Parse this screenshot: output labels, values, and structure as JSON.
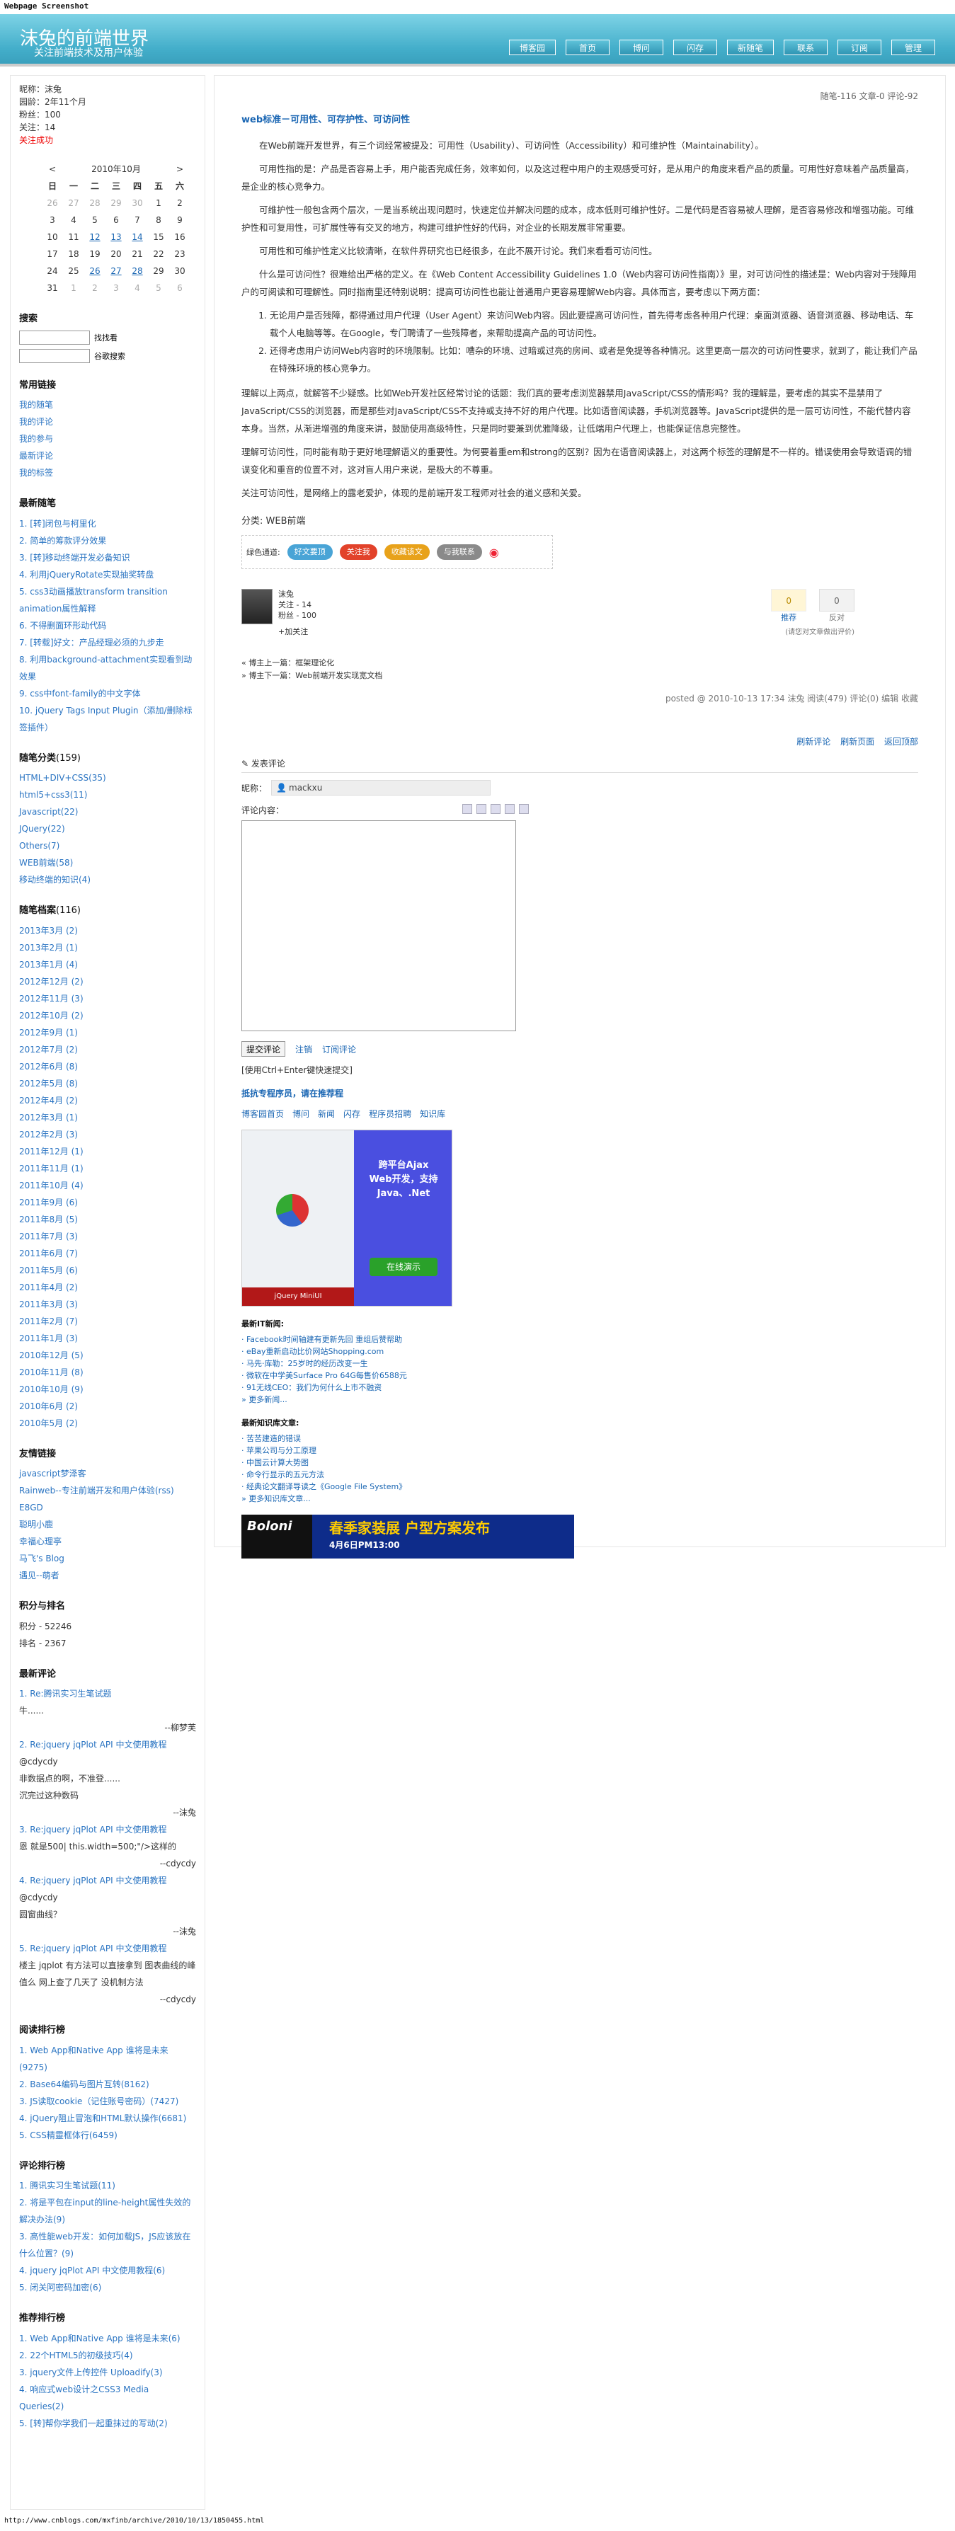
{
  "page_heading": "Webpage Screenshot",
  "blog": {
    "title": "沫兔的前端世界",
    "subtitle": "关注前端技术及用户体验"
  },
  "nav": [
    "博客园",
    "首页",
    "博问",
    "闪存",
    "新随笔",
    "联系",
    "订阅",
    "管理"
  ],
  "profile": {
    "nick": "昵称：沫兔",
    "age": "园龄：2年11个月",
    "fans": "粉丝：100",
    "follow": "关注：14",
    "added": "关注成功"
  },
  "calendar": {
    "caption": "2010年10月",
    "prev": "<",
    "next": ">",
    "weekdays": [
      "日",
      "一",
      "二",
      "三",
      "四",
      "五",
      "六"
    ],
    "rows": [
      [
        "26",
        "27",
        "28",
        "29",
        "30",
        "1",
        "2"
      ],
      [
        "3",
        "4",
        "5",
        "6",
        "7",
        "8",
        "9"
      ],
      [
        "10",
        "11",
        "12",
        "13",
        "14",
        "15",
        "16"
      ],
      [
        "17",
        "18",
        "19",
        "20",
        "21",
        "22",
        "23"
      ],
      [
        "24",
        "25",
        "26",
        "27",
        "28",
        "29",
        "30"
      ],
      [
        "31",
        "1",
        "2",
        "3",
        "4",
        "5",
        "6"
      ]
    ]
  },
  "search": {
    "title": "搜索",
    "btn1": "找找看",
    "btn2": "谷歌搜索"
  },
  "links": {
    "title": "常用链接",
    "items": [
      "我的随笔",
      "我的评论",
      "我的参与",
      "最新评论",
      "我的标签"
    ]
  },
  "recent_posts": {
    "title": "最新随笔",
    "items": [
      "1. [转]闭包与柯里化",
      "2. 简单的筹款评分效果",
      "3. [转]移动终端开发必备知识",
      "4. 利用jQueryRotate实现抽奖转盘",
      "5. css3动画播放transform transition animation属性解释",
      "6. 不得删面环形动代码",
      "7. [转载]好文：产品经理必须的九步走",
      "8. 利用background-attachment实现看到动效果",
      "9. css中font-family的中文字体",
      "10. jQuery Tags Input Plugin（添加/删除标签插件）"
    ]
  },
  "categories": {
    "title": "随笔分类",
    "count": "(159)",
    "items": [
      "HTML+DIV+CSS(35)",
      "html5+css3(11)",
      "Javascript(22)",
      "JQuery(22)",
      "Others(7)",
      "WEB前端(58)",
      "移动终端的知识(4)"
    ]
  },
  "archive": {
    "title": "随笔档案",
    "count": "(116)",
    "items": [
      "2013年3月 (2)",
      "2013年2月 (1)",
      "2013年1月 (4)",
      "2012年12月 (2)",
      "2012年11月 (3)",
      "2012年10月 (2)",
      "2012年9月 (1)",
      "2012年7月 (2)",
      "2012年6月 (8)",
      "2012年5月 (8)",
      "2012年4月 (2)",
      "2012年3月 (1)",
      "2012年2月 (3)",
      "2011年12月 (1)",
      "2011年11月 (1)",
      "2011年10月 (4)",
      "2011年9月 (6)",
      "2011年8月 (5)",
      "2011年7月 (3)",
      "2011年6月 (7)",
      "2011年5月 (6)",
      "2011年4月 (2)",
      "2011年3月 (3)",
      "2011年2月 (7)",
      "2011年1月 (3)",
      "2010年12月 (5)",
      "2010年11月 (8)",
      "2010年10月 (9)",
      "2010年6月 (2)",
      "2010年5月 (2)"
    ]
  },
  "friends": {
    "title": "友情链接",
    "items": [
      "javascript梦泽客",
      "Rainweb--专注前端开发和用户体验(rss)",
      "E8GD",
      "聪明小鹿",
      "幸福心理亭",
      "马飞's Blog",
      "遇见--萌者"
    ]
  },
  "score": {
    "title": "积分与排名",
    "points": "积分 - 52246",
    "rank": "排名 - 2367"
  },
  "latest_comments": {
    "title": "最新评论",
    "items": [
      {
        "title": "1. Re:腾讯实习生笔试题",
        "body": "牛......",
        "by": "--柳梦芙"
      },
      {
        "title": "2. Re:jquery jqPlot API 中文使用教程",
        "body": "@cdycdy\n非数据点的啊，不准登......\n沉完过这种数码",
        "by": "--沫兔"
      },
      {
        "title": "3. Re:jquery jqPlot API 中文使用教程",
        "body": "恩 就是500| this.width=500;\"/>这样的",
        "by": "--cdycdy"
      },
      {
        "title": "4. Re:jquery jqPlot API 中文使用教程",
        "body": "@cdycdy\n圆窗曲线？",
        "by": "--沫兔"
      },
      {
        "title": "5. Re:jquery jqPlot API 中文使用教程",
        "body": "楼主 jqplot 有方法可以直接拿到 图表曲线的峰值么 网上查了几天了 没机制方法",
        "by": "--cdycdy"
      }
    ]
  },
  "read_rank": {
    "title": "阅读排行榜",
    "items": [
      "1. Web App和Native App 谁将是未来(9275)",
      "2. Base64编码与图片互转(8162)",
      "3. JS读取cookie（记住账号密码）(7427)",
      "4. jQuery阻止冒泡和HTML默认操作(6681)",
      "5. CSS精靈框体行(6459)"
    ]
  },
  "comment_rank": {
    "title": "评论排行榜",
    "items": [
      "1. 腾讯实习生笔试题(11)",
      "2. 将是平包在input的line-height属性失效的解决办法(9)",
      "3. 高性能web开发：如何加载JS，JS应该放在什么位置？(9)",
      "4. jquery jqPlot API 中文使用教程(6)",
      "5. 闭关阿密码加密(6)"
    ]
  },
  "recommend_rank": {
    "title": "推荐排行榜",
    "items": [
      "1. Web App和Native App 谁将是未来(6)",
      "2. 22个HTML5的初级技巧(4)",
      "3. jquery文件上传控件 Uploadify(3)",
      "4. 响应式web设计之CSS3 Media Queries(2)",
      "5. [转]帮你学我们一起重抹过的写动(2)"
    ]
  },
  "post": {
    "stats": "随笔-116  文章-0  评论-92",
    "title": "web标准－可用性、可存护性、可访问性",
    "p1": "在Web前端开发世界，有三个词经常被提及：可用性（Usability）、可访问性（Accessibility）和可维护性（Maintainability）。",
    "p2": "可用性指的是：产品是否容易上手，用户能否完成任务，效率如何，以及这过程中用户的主观感受可好，是从用户的角度来看产品的质量。可用性好意味着产品质量高，是企业的核心竞争力。",
    "p3": "可维护性一般包含两个层次，一是当系统出现问题时，快速定位并解决问题的成本，成本低则可维护性好。二是代码是否容易被人理解，是否容易修改和增强功能。可维护性和可复用性，可扩展性等有交叉的地方，构建可维护性好的代码，对企业的长期发展非常重要。",
    "p4": "可用性和可维护性定义比较清晰，在软件界研究也已经很多，在此不展开讨论。我们来看看可访问性。",
    "p5": "什么是可访问性？很难给出严格的定义。在《Web Content Accessibility Guidelines 1.0（Web内容可访问性指南）》里，对可访问性的描述是：Web内容对于残障用户的可阅读和可理解性。同时指南里还特别说明：提高可访问性也能让普通用户更容易理解Web内容。具体而言，要考虑以下两方面：",
    "li1": "无论用户是否残障，都得通过用户代理（User Agent）来访问Web内容。因此要提高可访问性，首先得考虑各种用户代理：桌面浏览器、语音浏览器、移动电话、车载个人电脑等等。在Google，专门聘请了一些残障者，来帮助提高产品的可访问性。",
    "li2": "还得考虑用户访问Web内容时的环境限制。比如：嘈杂的环境、过暗或过亮的房间、或者是免提等各种情况。这里更高一层次的可访问性要求，就到了，能让我们产品在特殊环境的核心竞争力。",
    "p6": "理解以上两点，就解答不少疑惑。比如Web开发社区经常讨论的话题：我们真的要考虑浏览器禁用JavaScript/CSS的情形吗？我的理解是，要考虑的其实不是禁用了JavaScript/CSS的浏览器，而是那些对JavaScript/CSS不支持或支持不好的用户代理。比如语音阅读器，手机浏览器等。JavaScript提供的是一层可访问性，不能代替内容本身。当然，从渐进增强的角度来讲，鼓励使用高级特性，只是同时要兼到优雅降级，让低端用户代理上，也能保证信息完整性。",
    "p7": "理解可访问性，同时能有助于更好地理解语义的重要性。为何要着重em和strong的区别？因为在语音阅读器上，对这两个标签的理解是不一样的。错误使用会导致语调的错误变化和重音的位置不对，这对盲人用户来说，是极大的不尊重。",
    "p8": "关注可访问性，是网络上的露老爱护，体现的是前端开发工程师对社会的道义感和关爱。",
    "category": "分类: WEB前端",
    "share_label": "绿色通道:",
    "share_btns": [
      "好文要顶",
      "关注我",
      "收藏该文",
      "与我联系"
    ],
    "author_name": "沫兔",
    "author_follow": "关注 - 14",
    "author_fans": "粉丝 - 100",
    "plus_follow": "+加关注",
    "digg": "0",
    "bury": "0",
    "digg_label": "推荐",
    "bury_label": "反对",
    "vote_note": "(请您对文章做出评价)",
    "prev": "« 博主上一篇：框架理论化",
    "next": "» 博主下一篇：Web前端开发实现宽文档",
    "postfoot": "posted @ 2010-10-13 17:34 沫兔 阅读(479) 评论(0) 编辑 收藏",
    "flinks": [
      "刷新评论",
      "刷新页面",
      "返回顶部"
    ]
  },
  "comment_form": {
    "title": "发表评论",
    "nick_label": "昵称：",
    "nick_value": "mackxu",
    "content_label": "评论内容：",
    "submit": "提交评论",
    "logout": "注销",
    "subscribe": "订阅评论",
    "hint": "[使用Ctrl+Enter键快速提交]"
  },
  "extras": {
    "ad_hint": "抵抗专程序员，请在推荐程",
    "site_links": [
      "博客园首页",
      "博问",
      "新闻",
      "闪存",
      "程序员招聘",
      "知识库"
    ],
    "ad1_text": "跨平台Ajax Web开发，支持Java、.Net",
    "ad1_btn": "在线演示",
    "ad1_brand": "jQuery MiniUI",
    "news_title": "最新IT新闻:",
    "news": [
      "· Facebook时间轴建有更新先回 重组后赞帮助",
      "· eBay重新启动比价网站Shopping.com",
      "· 马先·库勒：25岁时的经历改变一生",
      "· 微软在中学美Surface Pro 64G每售价6588元",
      "· 91无线CEO：我们为何什么上市不融资",
      "» 更多新闻..."
    ],
    "kb_title": "最新知识库文章:",
    "kb": [
      "· 苦苦建造的错误",
      "· 苹果公司与分工原理",
      "· 中国云计算大势图",
      "· 命令行显示的五元方法",
      "· 经典论文翻译导读之《Google File System》",
      "» 更多知识库文章..."
    ],
    "ad2_logo": "Boloni",
    "ad2_title": "春季家装展  户型方案发布",
    "ad2_date": "4月6日PM13:00"
  },
  "footer_url": "http://www.cnblogs.com/mxfinb/archive/2010/10/13/1850455.html"
}
